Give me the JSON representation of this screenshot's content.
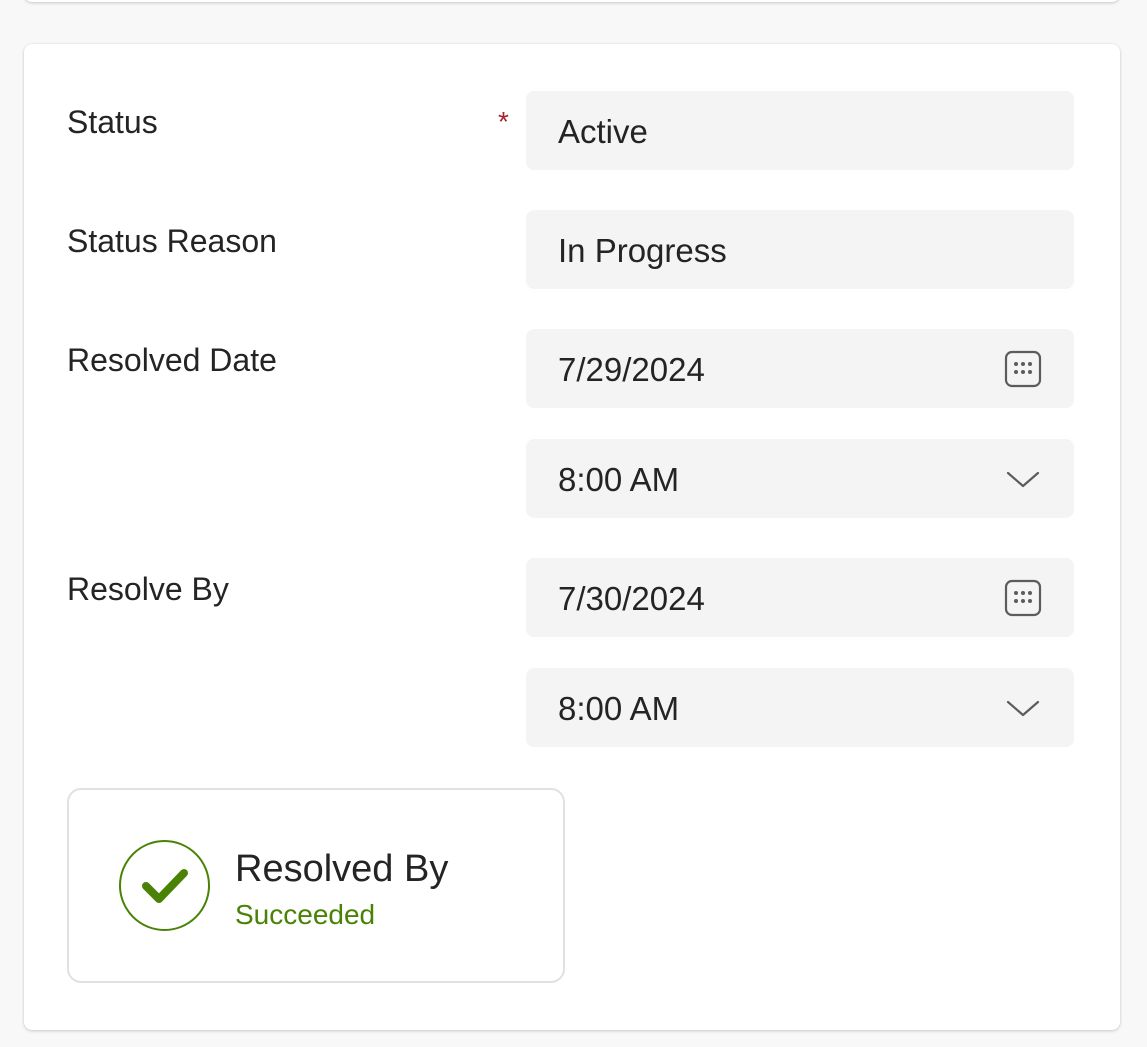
{
  "form": {
    "status": {
      "label": "Status",
      "required_marker": "*",
      "value": "Active"
    },
    "status_reason": {
      "label": "Status Reason",
      "value": "In Progress"
    },
    "resolved_date": {
      "label": "Resolved Date",
      "date": "7/29/2024",
      "time": "8:00 AM"
    },
    "resolve_by": {
      "label": "Resolve By",
      "date": "7/30/2024",
      "time": "8:00 AM"
    }
  },
  "tile": {
    "title": "Resolved By",
    "status": "Succeeded"
  },
  "icons": {
    "calendar": "calendar-icon",
    "chevron": "chevron-down-icon",
    "check": "checkmark-icon"
  },
  "colors": {
    "success": "#498205",
    "required": "#a4262c",
    "field_bg": "#f4f4f4"
  }
}
